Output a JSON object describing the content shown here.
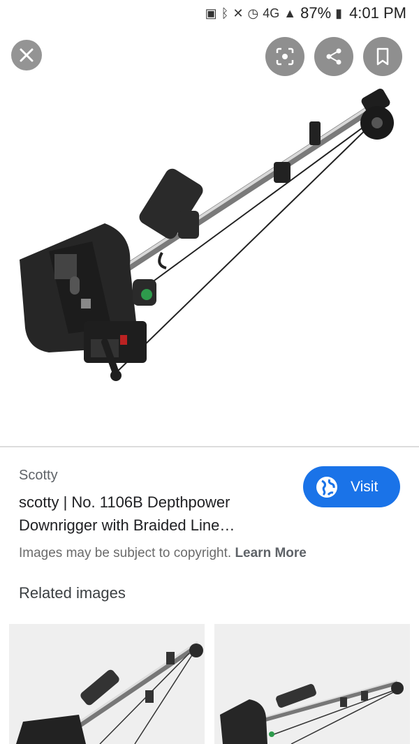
{
  "status_bar": {
    "battery_percent": "87%",
    "time": "4:01 PM",
    "network": "4G",
    "icons": [
      "battery-saver-icon",
      "bluetooth-icon",
      "mute-icon",
      "alarm-icon",
      "lte-icon",
      "signal-icon",
      "battery-icon"
    ]
  },
  "toolbar": {
    "icons": [
      "close-icon",
      "lens-search-icon",
      "share-icon",
      "bookmark-icon"
    ]
  },
  "result": {
    "source": "Scotty",
    "title_line1": "scotty | No. 1106B Depthpower",
    "title_line2": "Downrigger with Braided Line…",
    "visit_label": "Visit",
    "copyright_text": "Images may be subject to copyright.",
    "learn_more": "Learn More"
  },
  "related": {
    "heading": "Related images"
  },
  "colors": {
    "accent": "#1a73e8",
    "overlay_button": "#8f8f8f"
  }
}
